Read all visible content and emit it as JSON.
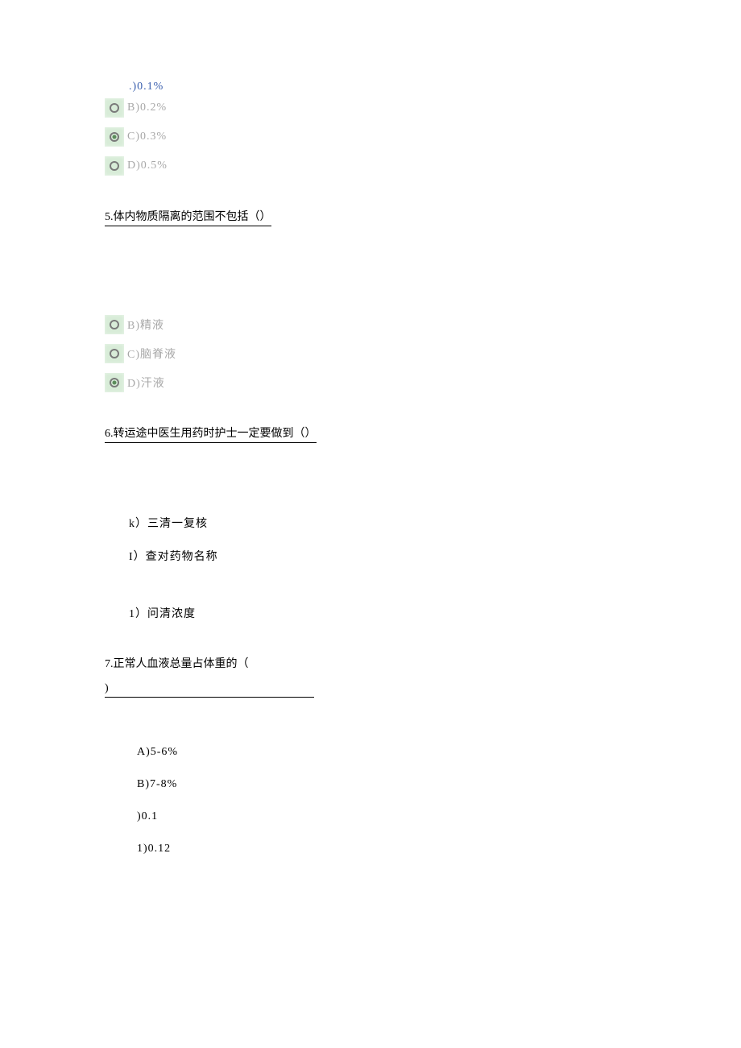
{
  "q4": {
    "optA": ".)0.1%",
    "optB": "B)0.2%",
    "optC": "C)0.3%",
    "optD": "D)0.5%"
  },
  "q5": {
    "title": "5.体内物质隔离的范围不包括（）",
    "optB": "B)精液",
    "optC": "C)脑脊液",
    "optD": "D)汗液"
  },
  "q6": {
    "title": "6.转运途中医生用药时护士一定要做到（）",
    "itemK": "k）三清一复核",
    "itemI": "I）查对药物名称",
    "item1": "1）问清浓度"
  },
  "q7": {
    "title1": "7.正常人血液总量占体重的（",
    "title2": ")",
    "optA": "A)5-6%",
    "optB": "B)7-8%",
    "optC": ")0.1",
    "optD": "1)0.12"
  }
}
